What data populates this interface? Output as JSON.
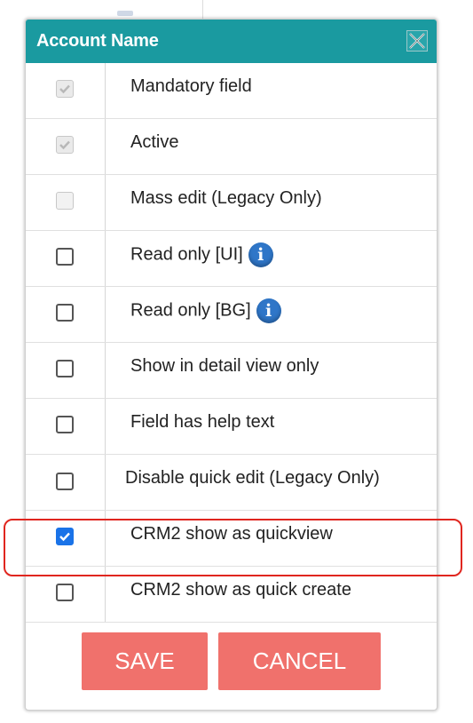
{
  "dialog": {
    "title": "Account Name",
    "close_icon": "close-x-icon"
  },
  "rows": [
    {
      "label": "Mandatory field",
      "state": "checked-disabled"
    },
    {
      "label": "Active",
      "state": "checked-disabled"
    },
    {
      "label": "Mass edit (Legacy Only)",
      "state": "disabled"
    },
    {
      "label": "Read only [UI]",
      "state": "unchecked",
      "info_icon": true
    },
    {
      "label": "Read only [BG]",
      "state": "unchecked",
      "info_icon": true
    },
    {
      "label": "Show in detail view only",
      "state": "unchecked"
    },
    {
      "label": "Field has help text",
      "state": "unchecked"
    },
    {
      "label": "Disable quick edit (Legacy Only)",
      "state": "unchecked"
    },
    {
      "label": "CRM2 show as quickview",
      "state": "checked"
    },
    {
      "label": "CRM2 show as quick create",
      "state": "unchecked"
    }
  ],
  "footer": {
    "save_label": "SAVE",
    "cancel_label": "CANCEL"
  },
  "colors": {
    "header": "#1a9aa0",
    "button": "#f0716c",
    "checked": "#1a73e8",
    "highlight": "#e0261f"
  }
}
